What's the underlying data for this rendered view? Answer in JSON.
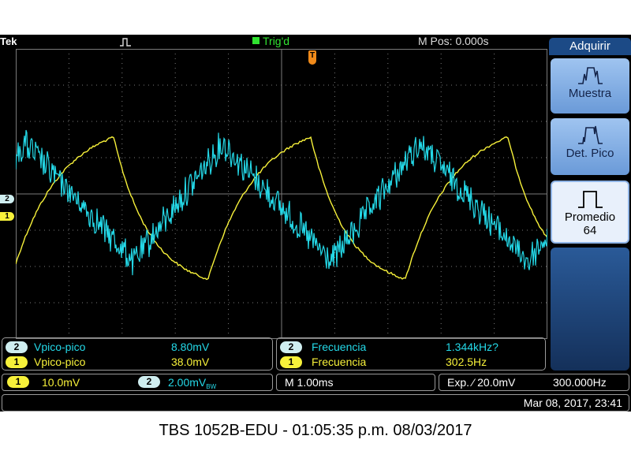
{
  "scope": {
    "brand": "Tek",
    "trigger_status": "Trig'd",
    "m_pos": "M Pos: 0.000s",
    "ch2_marker": "2",
    "ch1_marker": "1",
    "trigger_marker": "T"
  },
  "side_menu": {
    "title": "Adquirir",
    "buttons": [
      {
        "label": "Muestra"
      },
      {
        "label": "Det. Pico"
      },
      {
        "label": "Promedio",
        "sub": "64"
      }
    ]
  },
  "measurements": {
    "left": [
      {
        "channel": "2",
        "label": "Vpico-pico",
        "value": "8.80mV",
        "color": "#24d9e8"
      },
      {
        "channel": "1",
        "label": "Vpico-pico",
        "value": "38.0mV",
        "color": "#f7f13a"
      }
    ],
    "right": [
      {
        "channel": "2",
        "label": "Frecuencia",
        "value": "1.344kHz?",
        "color": "#24d9e8"
      },
      {
        "channel": "1",
        "label": "Frecuencia",
        "value": "302.5Hz",
        "color": "#f7f13a"
      }
    ]
  },
  "info_bar": {
    "ch1_badge": "1",
    "ch1_scale": "10.0mV",
    "ch2_badge": "2",
    "ch2_scale": "2.00mV",
    "ch2_bw_suffix": "BW",
    "timebase": "M 1.00ms",
    "trigger": "Exp. ⁄ 20.0mV",
    "trigger_freq": "300.000Hz",
    "datetime": "Mar 08, 2017, 23:41"
  },
  "caption": "TBS 1052B-EDU - 01:05:35 p.m.   08/03/2017",
  "colors": {
    "ch1": "#f7f13a",
    "ch2": "#24d9e8",
    "trigger": "#31e331",
    "graticule": "#7a7a7a",
    "menu": "#1c4a86"
  }
}
